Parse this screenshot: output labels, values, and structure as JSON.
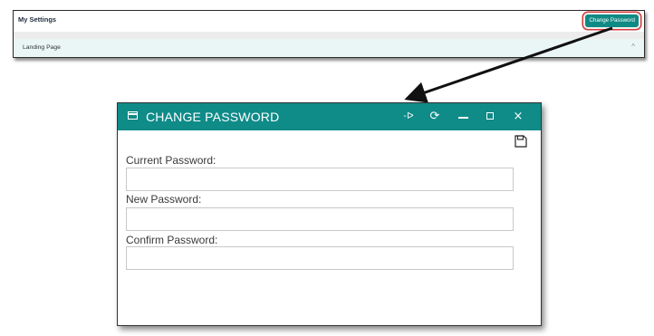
{
  "settings": {
    "title": "My Settings",
    "change_password_button": "Change Password",
    "landing_page_label": "Landing Page",
    "collapse_glyph": "^"
  },
  "dialog": {
    "title": "CHANGE PASSWORD",
    "icons": {
      "window": "window-icon",
      "pin": "pin-icon",
      "refresh": "refresh-icon",
      "minimize": "minimize-icon",
      "maximize": "maximize-icon",
      "close": "close-icon",
      "save": "save-icon"
    },
    "close_glyph": "×",
    "pin_glyph": "-ᐅ",
    "refresh_glyph": "⟳",
    "fields": [
      {
        "label": "Current Password:",
        "value": ""
      },
      {
        "label": "New Password:",
        "value": ""
      },
      {
        "label": "Confirm Password:",
        "value": ""
      }
    ]
  },
  "colors": {
    "teal": "#0f8b88",
    "highlight_ring": "#d23a3a"
  }
}
